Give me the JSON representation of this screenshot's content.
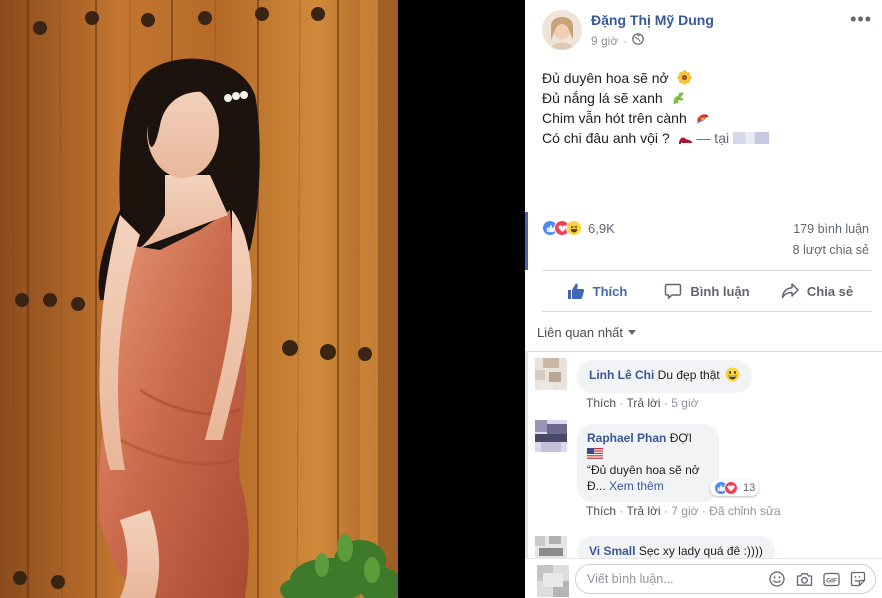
{
  "post": {
    "author_name": "Đặng Thị Mỹ Dung",
    "time": "9 giờ",
    "privacy_icon": "globe-icon",
    "lines": [
      {
        "text": "Đủ duyên hoa sẽ nở",
        "emoji": "sunflower-icon"
      },
      {
        "text": "Đủ nắng lá sẽ xanh",
        "emoji": "herb-icon"
      },
      {
        "text": "Chim vẫn hót trên cành",
        "emoji": "parrot-icon"
      },
      {
        "text": "Có chi đâu anh vội ?",
        "emoji": "high-heel-icon"
      }
    ],
    "location_prefix": "— tại"
  },
  "stats": {
    "reaction_icons": [
      "like-icon",
      "love-icon",
      "haha-icon"
    ],
    "reactions_count": "6,9K",
    "comments": "179 bình luận",
    "shares": "8 lượt chia sẻ"
  },
  "actions": {
    "like": "Thích",
    "comment": "Bình luận",
    "share": "Chia sẻ"
  },
  "sort_label": "Liên quan nhất",
  "comments": [
    {
      "name": "Linh Lê Chi",
      "text": "Du đẹp thật",
      "emoji": "grinning-face-icon",
      "like_label": "Thích",
      "reply_label": "Trả lời",
      "time": "5 giờ"
    },
    {
      "name": "Raphael Phan",
      "text_line1": "ĐỢI",
      "flag": "us-flag-icon",
      "quote_line1": "“Đủ duyên hoa sẽ nở",
      "quote_line2": "Đ...",
      "see_more": "Xem thêm",
      "reaction_count": "13",
      "like_label": "Thích",
      "reply_label": "Trả lời",
      "time": "7 giờ",
      "edited": "Đã chỉnh sửa"
    },
    {
      "name": "Vi Small",
      "text": "Sẹc xy lady quá đê :))))"
    }
  ],
  "composer": {
    "placeholder": "Viết bình luận...",
    "icons": [
      "emoji-icon",
      "camera-icon",
      "gif-icon",
      "sticker-icon"
    ]
  },
  "colors": {
    "link_blue": "#385898",
    "brand_blue": "#4267b2",
    "meta_gray": "#90949c",
    "bubble_bg": "#f2f3f5"
  }
}
